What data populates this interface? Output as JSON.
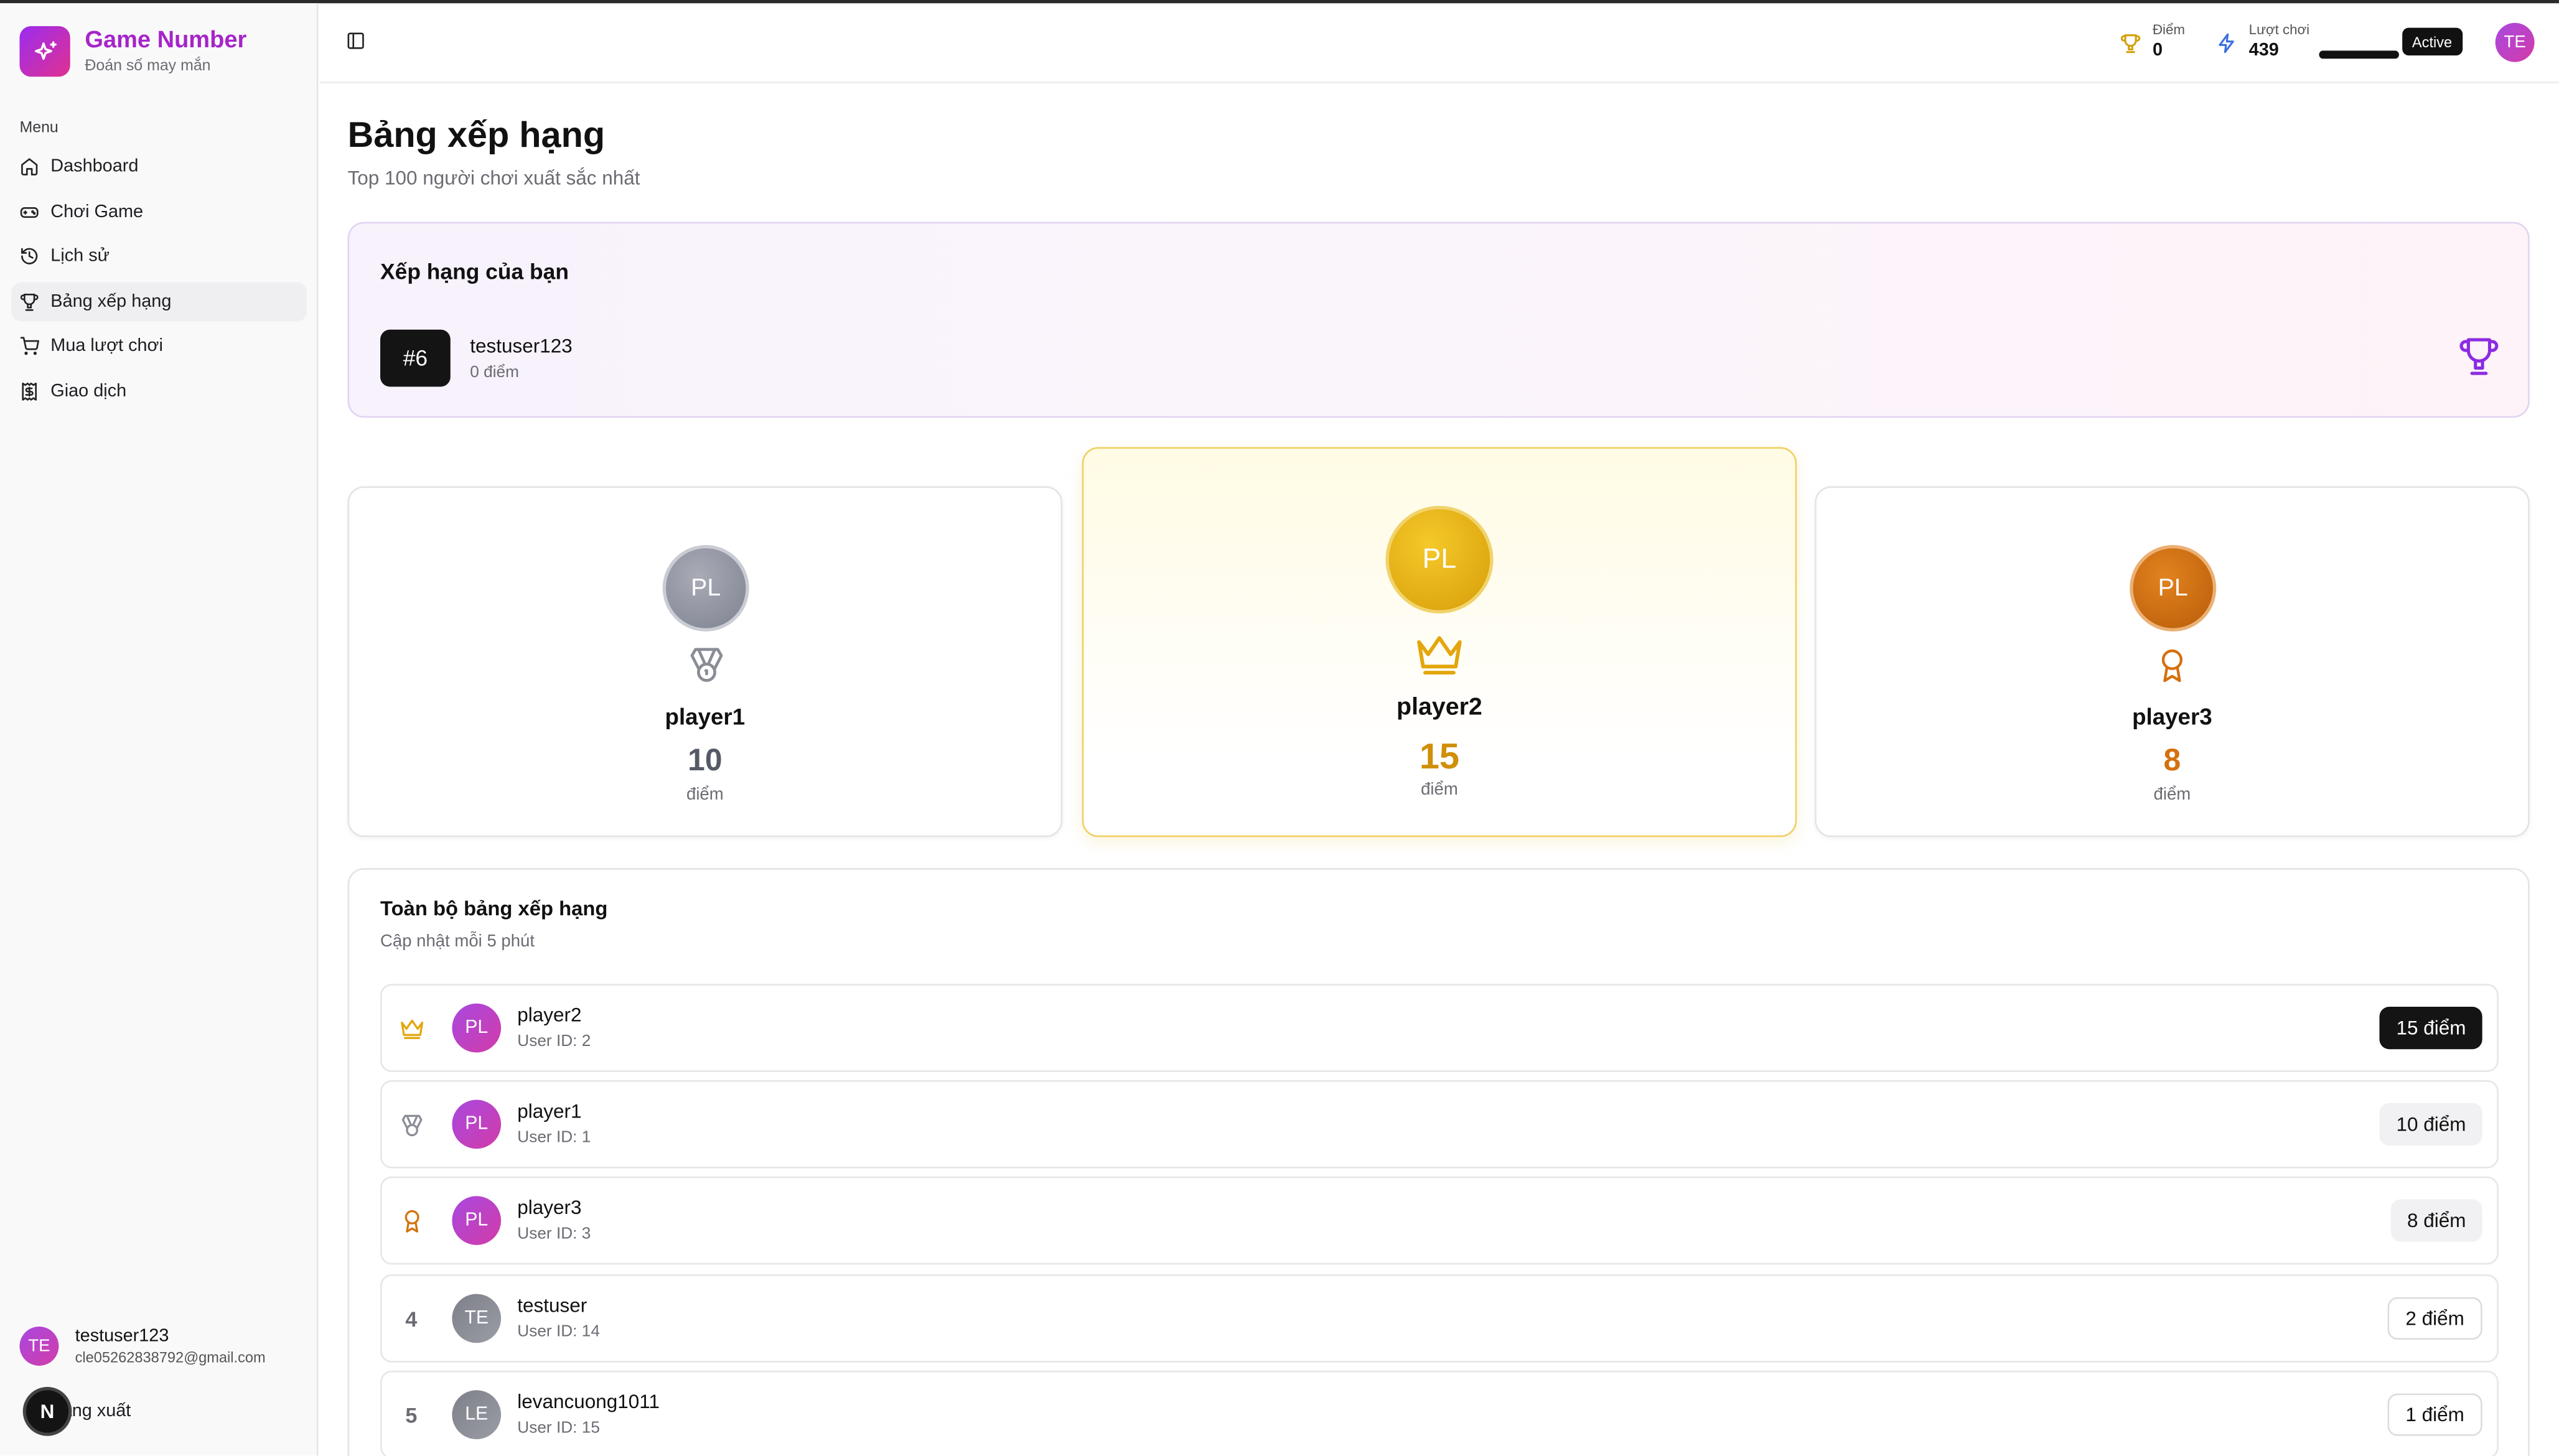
{
  "app": {
    "title": "Game Number",
    "subtitle": "Đoán số may mắn",
    "brand_color": "#a624c9"
  },
  "sidebar": {
    "menu_label": "Menu",
    "items": [
      {
        "label": "Dashboard",
        "icon": "home-icon"
      },
      {
        "label": "Chơi Game",
        "icon": "gamepad-icon"
      },
      {
        "label": "Lịch sử",
        "icon": "history-icon"
      },
      {
        "label": "Bảng xếp hạng",
        "icon": "trophy-icon",
        "active": true
      },
      {
        "label": "Mua lượt chơi",
        "icon": "cart-icon"
      },
      {
        "label": "Giao dịch",
        "icon": "receipt-icon"
      }
    ],
    "user": {
      "initials": "TE",
      "name": "testuser123",
      "email": "cle05262838792@gmail.com"
    },
    "logout_label": "Đăng xuất",
    "logout_display": "ăng xuất",
    "next_badge": "N"
  },
  "header": {
    "points_label": "Điểm",
    "points_value": "0",
    "turns_label": "Lượt chơi",
    "turns_value": "439",
    "turns_progress": 1.0,
    "status": "Active",
    "avatar_initials": "TE"
  },
  "page": {
    "title": "Bảng xếp hạng",
    "subtitle": "Top 100 người chơi xuất sắc nhất"
  },
  "my_rank": {
    "title": "Xếp hạng của bạn",
    "rank": "#6",
    "name": "testuser123",
    "score": "0 điểm"
  },
  "podium": {
    "first": {
      "initials": "PL",
      "name": "player2",
      "score": "15",
      "unit": "điểm",
      "icon": "crown-icon"
    },
    "second": {
      "initials": "PL",
      "name": "player1",
      "score": "10",
      "unit": "điểm",
      "icon": "medal-icon"
    },
    "third": {
      "initials": "PL",
      "name": "player3",
      "score": "8",
      "unit": "điểm",
      "icon": "award-icon"
    }
  },
  "leaderboard": {
    "title": "Toàn bộ bảng xếp hạng",
    "subtitle": "Cập nhật mỗi 5 phút",
    "rows": [
      {
        "rank": "",
        "rank_icon": "crown-icon",
        "initials": "PL",
        "name": "player2",
        "user_id": "User ID: 2",
        "score": "15 điểm"
      },
      {
        "rank": "",
        "rank_icon": "medal-icon",
        "initials": "PL",
        "name": "player1",
        "user_id": "User ID: 1",
        "score": "10 điểm"
      },
      {
        "rank": "",
        "rank_icon": "award-icon",
        "initials": "PL",
        "name": "player3",
        "user_id": "User ID: 3",
        "score": "8 điểm"
      },
      {
        "rank": "4",
        "rank_icon": "",
        "initials": "TE",
        "name": "testuser",
        "user_id": "User ID: 14",
        "score": "2 điểm"
      },
      {
        "rank": "5",
        "rank_icon": "",
        "initials": "LE",
        "name": "levancuong1011",
        "user_id": "User ID: 15",
        "score": "1 điểm"
      }
    ]
  },
  "colors": {
    "gold": "#e3a60c",
    "silver": "#8a8d96",
    "bronze": "#d4700d",
    "accent_purple": "#8b2be2"
  }
}
